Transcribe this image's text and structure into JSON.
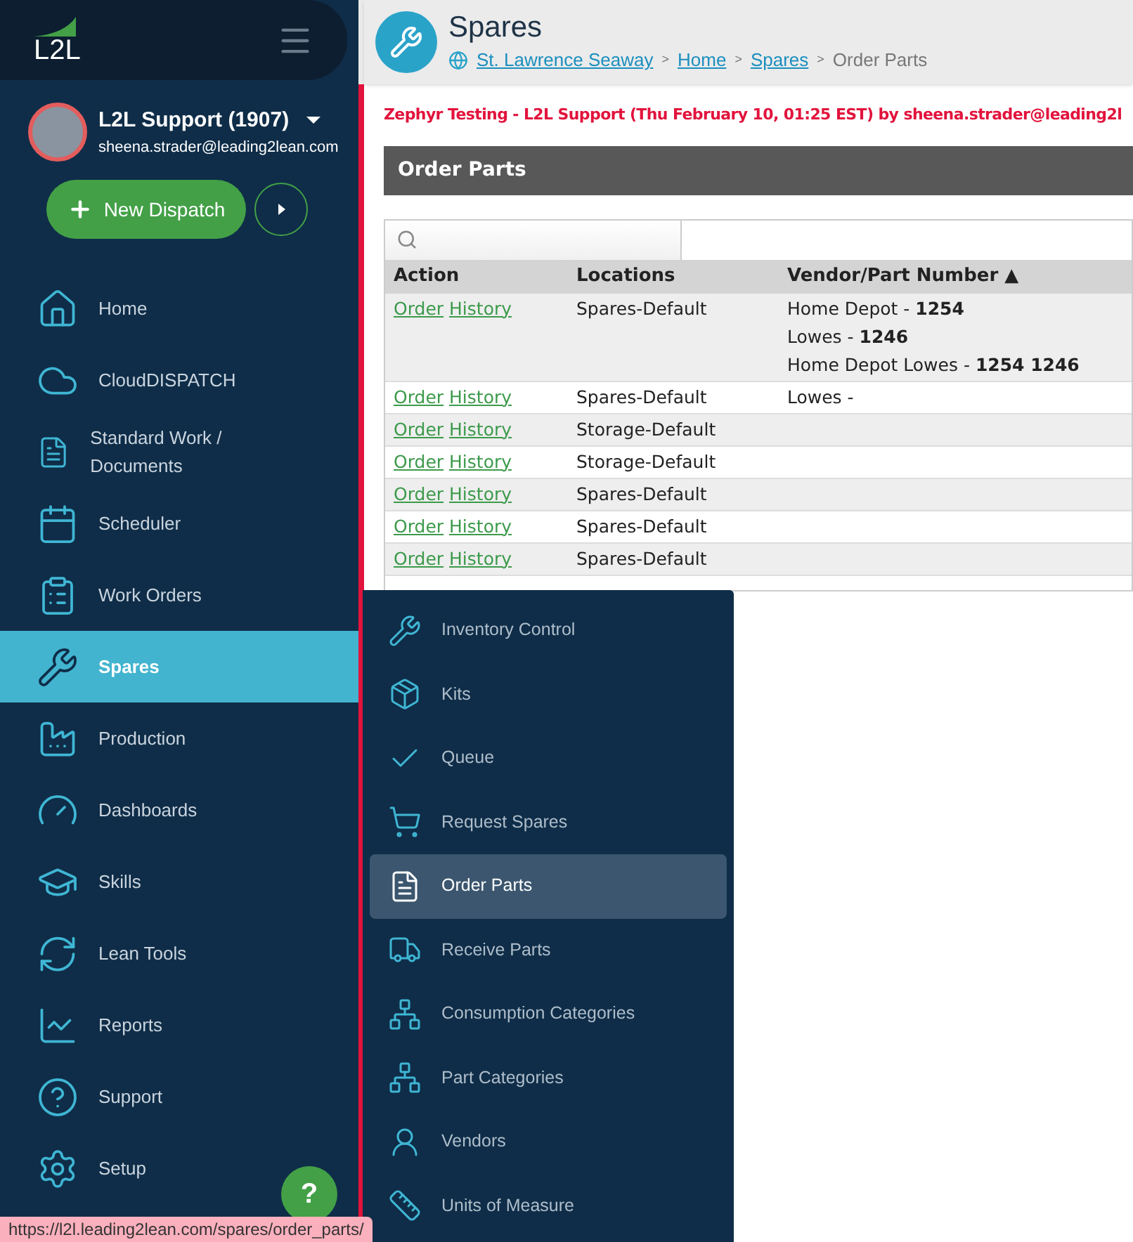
{
  "sidebar": {
    "logo": "L2L",
    "user": {
      "name": "L2L Support (1907)",
      "email": "sheena.strader@leading2lean.com"
    },
    "new_button": "New Dispatch",
    "items": [
      {
        "label": "Home",
        "selected": false
      },
      {
        "label": "CloudDISPATCH",
        "selected": false
      },
      {
        "label": "Standard Work / Documents",
        "selected": false
      },
      {
        "label": "Scheduler",
        "selected": false
      },
      {
        "label": "Work Orders",
        "selected": false
      },
      {
        "label": "Spares",
        "selected": true
      },
      {
        "label": "Production",
        "selected": false
      },
      {
        "label": "Dashboards",
        "selected": false
      },
      {
        "label": "Skills",
        "selected": false
      },
      {
        "label": "Lean Tools",
        "selected": false
      },
      {
        "label": "Reports",
        "selected": false
      },
      {
        "label": "Support",
        "selected": false
      },
      {
        "label": "Setup",
        "selected": false
      }
    ],
    "help_button": "?"
  },
  "header": {
    "title": "Spares",
    "breadcrumbs": [
      {
        "label": "St. Lawrence Seaway",
        "link": true
      },
      {
        "label": "Home",
        "link": true
      },
      {
        "label": "Spares",
        "link": true
      },
      {
        "label": "Order Parts",
        "link": false
      }
    ],
    "separator": ">"
  },
  "notice": "Zephyr Testing - L2L Support (Thu February 10, 01:25 EST) by sheena.strader@leading2l",
  "panel_title": "Order Parts",
  "table": {
    "columns": [
      "Action",
      "Locations",
      "Vendor/Part Number ▲"
    ],
    "rows": [
      {
        "actions": [
          "Order",
          "History"
        ],
        "location": "Spares-Default",
        "vendors": [
          "Home Depot - **1254**",
          "Lowes - **1246**",
          "Home Depot Lowes - **1254 1246**"
        ]
      },
      {
        "actions": [
          "Order",
          "History"
        ],
        "location": "Spares-Default",
        "vendors": [
          "Lowes -"
        ]
      },
      {
        "actions": [
          "Order",
          "History"
        ],
        "location": "Storage-Default",
        "vendors": []
      },
      {
        "actions": [
          "Order",
          "History"
        ],
        "location": "Storage-Default",
        "vendors": []
      },
      {
        "actions": [
          "Order",
          "History"
        ],
        "location": "Spares-Default",
        "vendors": []
      },
      {
        "actions": [
          "Order",
          "History"
        ],
        "location": "Spares-Default",
        "vendors": []
      },
      {
        "actions": [
          "Order",
          "History"
        ],
        "location": "Spares-Default",
        "vendors": []
      }
    ]
  },
  "flyout": {
    "items": [
      {
        "label": "Inventory Control",
        "selected": false
      },
      {
        "label": "Kits",
        "selected": false
      },
      {
        "label": "Queue",
        "selected": false
      },
      {
        "label": "Request Spares",
        "selected": false
      },
      {
        "label": "Order Parts",
        "selected": true
      },
      {
        "label": "Receive Parts",
        "selected": false
      },
      {
        "label": "Consumption Categories",
        "selected": false
      },
      {
        "label": "Part Categories",
        "selected": false
      },
      {
        "label": "Vendors",
        "selected": false
      },
      {
        "label": "Units of Measure",
        "selected": false
      }
    ]
  },
  "status_bar": "https://l2l.leading2lean.com/spares/order_parts/"
}
